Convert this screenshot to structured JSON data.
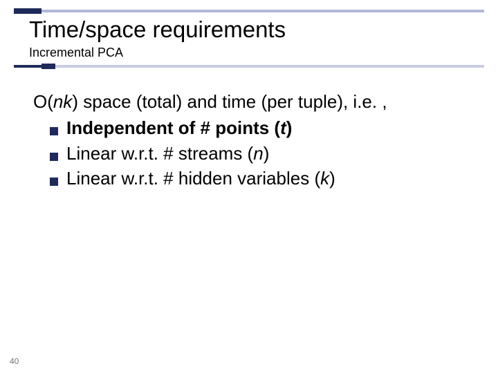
{
  "slide": {
    "title": "Time/space requirements",
    "subtitle": "Incremental PCA",
    "lead_prefix": "O(",
    "lead_var": "nk",
    "lead_suffix": ") space (total) and time (per tuple), i.e. ,",
    "bullets": [
      {
        "bold_prefix": "Independent of # points (",
        "bold_var": "t",
        "bold_suffix": ")",
        "plain": ""
      },
      {
        "plain_prefix": "Linear w.r.t. # streams (",
        "var": "n",
        "plain_suffix": ")"
      },
      {
        "plain_prefix": "Linear w.r.t. # hidden variables (",
        "var": "k",
        "plain_suffix": ")"
      }
    ],
    "page_number": "40"
  }
}
